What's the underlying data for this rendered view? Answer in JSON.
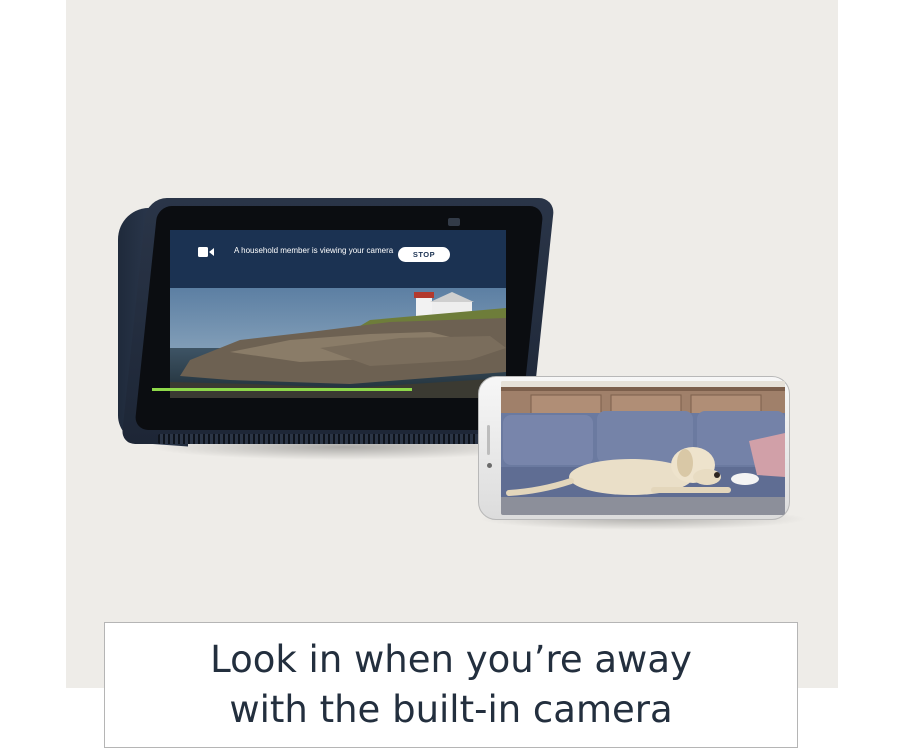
{
  "echo_screen": {
    "banner_icon": "video-camera-icon",
    "banner_text": "A household member is viewing your camera",
    "stop_label": "STOP",
    "progress_color": "#8ed84a",
    "banner_color": "#1b3252"
  },
  "phone_screen": {
    "scene": "dog lying on sofa"
  },
  "caption": {
    "line1": "Look in when you’re away",
    "line2": "with the built-in camera",
    "text_color": "#232f3e"
  }
}
